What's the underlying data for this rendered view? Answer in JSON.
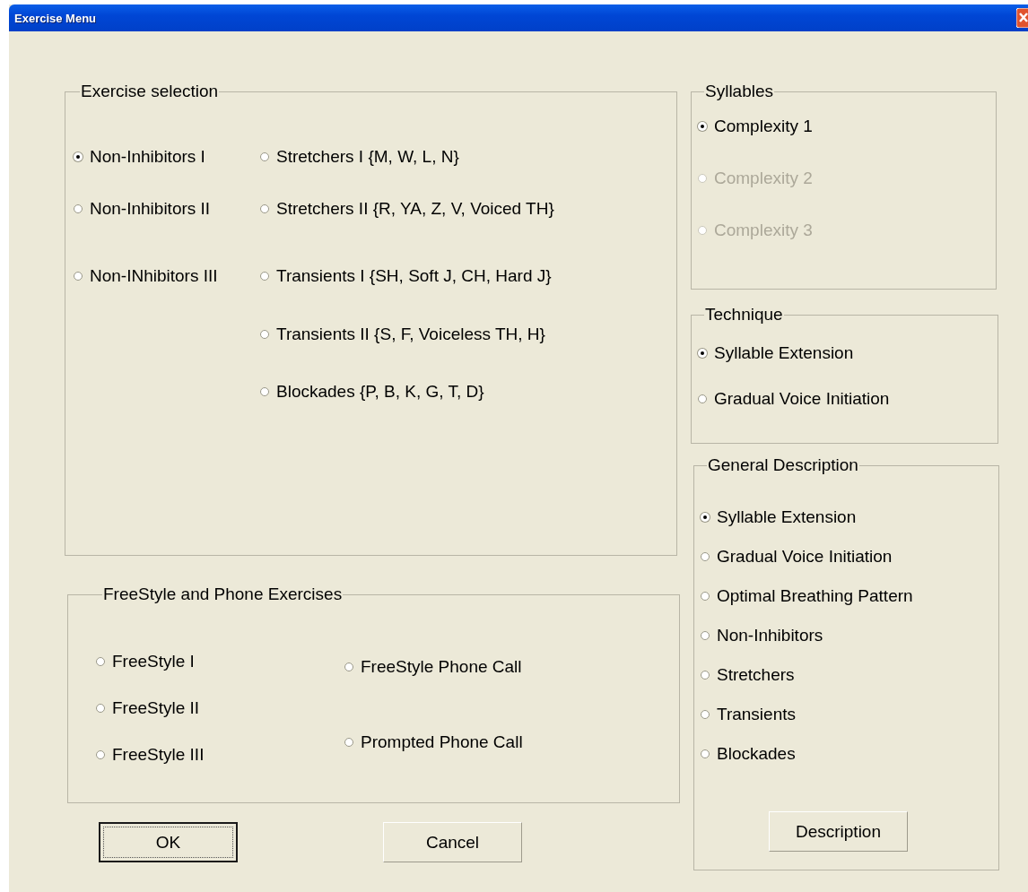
{
  "window": {
    "title": "Exercise Menu"
  },
  "exercise_selection": {
    "title": "Exercise selection",
    "columns": [
      [
        {
          "label": "Non-Inhibitors I",
          "selected": true
        },
        {
          "label": "Non-Inhibitors II",
          "selected": false
        },
        {
          "label": "Non-INhibitors III",
          "selected": false
        }
      ],
      [
        {
          "label": "Stretchers I {M, W, L, N}",
          "selected": false
        },
        {
          "label": "Stretchers II {R, YA, Z, V, Voiced TH}",
          "selected": false
        },
        {
          "label": "Transients I {SH, Soft J, CH, Hard J}",
          "selected": false
        },
        {
          "label": "Transients II {S, F, Voiceless TH, H}",
          "selected": false
        },
        {
          "label": "Blockades {P, B, K, G, T, D}",
          "selected": false
        }
      ]
    ]
  },
  "freestyle": {
    "title": "FreeStyle and Phone Exercises",
    "columns": [
      [
        {
          "label": "FreeStyle I",
          "selected": false
        },
        {
          "label": "FreeStyle II",
          "selected": false
        },
        {
          "label": "FreeStyle III",
          "selected": false
        }
      ],
      [
        {
          "label": "FreeStyle Phone Call",
          "selected": false
        },
        {
          "label": "Prompted Phone Call",
          "selected": false
        }
      ]
    ]
  },
  "buttons": [
    {
      "label": "OK",
      "default": true
    },
    {
      "label": "Cancel",
      "default": false
    }
  ],
  "syllables": {
    "title": "Syllables",
    "items": [
      {
        "label": "Complexity 1",
        "selected": true,
        "disabled": false
      },
      {
        "label": "Complexity 2",
        "selected": false,
        "disabled": true
      },
      {
        "label": "Complexity 3",
        "selected": false,
        "disabled": true
      }
    ]
  },
  "technique": {
    "title": "Technique",
    "items": [
      {
        "label": "Syllable Extension",
        "selected": true
      },
      {
        "label": "Gradual Voice Initiation",
        "selected": false
      }
    ]
  },
  "general_description": {
    "title": "General Description",
    "items": [
      {
        "label": "Syllable Extension",
        "selected": true
      },
      {
        "label": "Gradual Voice Initiation",
        "selected": false
      },
      {
        "label": "Optimal Breathing Pattern",
        "selected": false
      },
      {
        "label": "Non-Inhibitors",
        "selected": false
      },
      {
        "label": "Stretchers",
        "selected": false
      },
      {
        "label": "Transients",
        "selected": false
      },
      {
        "label": "Blockades",
        "selected": false
      }
    ],
    "button": "Description"
  }
}
